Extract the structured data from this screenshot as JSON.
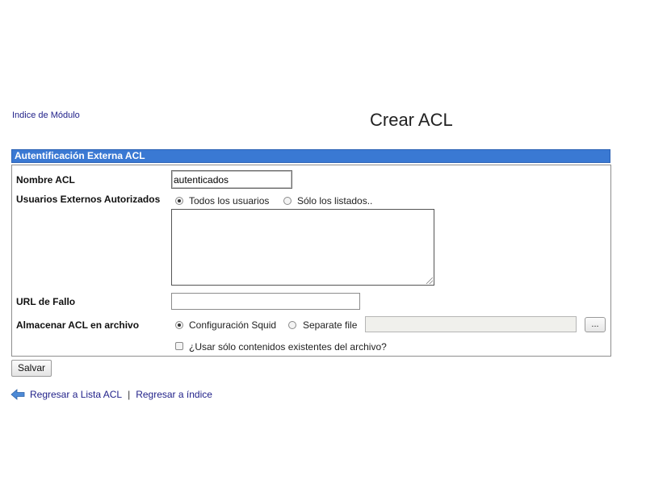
{
  "header": {
    "module_index_link": "Indice de Módulo",
    "title": "Crear ACL"
  },
  "section": {
    "title": "Autentificación Externa ACL"
  },
  "form": {
    "acl_name": {
      "label": "Nombre ACL",
      "value": "autenticados"
    },
    "external_users": {
      "label": "Usuarios Externos Autorizados",
      "options": [
        "Todos los usuarios",
        "Sólo los listados.."
      ],
      "selected": "Todos los usuarios",
      "list_value": ""
    },
    "fail_url": {
      "label": "URL de Fallo",
      "value": ""
    },
    "store_file": {
      "label": "Almacenar ACL en archivo",
      "options": [
        "Configuración Squid",
        "Separate file"
      ],
      "selected": "Configuración Squid",
      "file_path": "",
      "browse_label": "...",
      "use_existing_label": "¿Usar sólo contenidos existentes del archivo?",
      "use_existing_checked": false
    }
  },
  "actions": {
    "save_label": "Salvar"
  },
  "footer": {
    "back_acl_list": "Regresar a Lista ACL",
    "separator": "|",
    "back_index": "Regresar a índice"
  },
  "colors": {
    "section_bar": "#3a79d3",
    "link": "#22228a"
  }
}
